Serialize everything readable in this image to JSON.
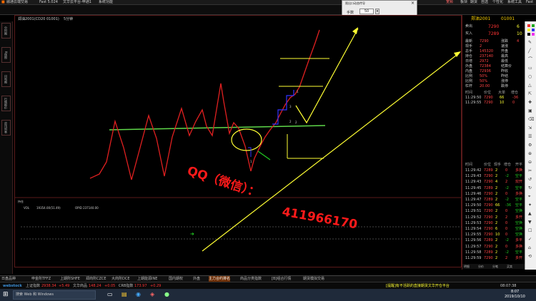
{
  "titlebar": {
    "app_name": "融通云端交易",
    "plate": "Fast  5.024",
    "menu_items": [
      "文华云平台-申通1",
      "系统功能"
    ],
    "right_menu": [
      "宽频",
      "板块",
      "期货",
      "自选",
      "个性化",
      "系统工具",
      "Fast"
    ]
  },
  "trade_panel": {
    "title": "限出口动态传导",
    "hand_label": "手数",
    "hand_value": "50",
    "close_label": "×"
  },
  "left_rail": {
    "tabs": [
      "分时图",
      "K线图",
      "闪电图",
      "行情报价",
      "资讯列表"
    ]
  },
  "chart": {
    "header": "郑油2001(CD20 01001)",
    "period": "5分钟",
    "watermark_prefix": "QQ（微信）：",
    "watermark_number": "411966170",
    "subpane_title": "持仓",
    "subpane_vol": "VOL",
    "subpane_readout": "19354.00(51.49)",
    "subpane_opi": "OPID 237140.00",
    "wave_labels": [
      "1",
      "2",
      "3",
      "1",
      "2"
    ]
  },
  "quote": {
    "symbol": "郑油2001",
    "code": "01001",
    "sell_label": "卖出",
    "sell_price": "7290",
    "sell_vol": "6",
    "buy_label": "买入",
    "buy_price": "7289",
    "buy_vol": "10",
    "stats": [
      {
        "l": "最新",
        "v": "7290",
        "l2": "涨跌",
        "v2": "4"
      },
      {
        "l": "现手",
        "v": "2",
        "l2": "速涨",
        "v2": ""
      },
      {
        "l": "总手",
        "v": "145320",
        "l2": "开盘",
        "v2": ""
      },
      {
        "l": "持仓",
        "v": "237140",
        "l2": "最高",
        "v2": ""
      },
      {
        "l": "日增",
        "v": "2972",
        "l2": "最低",
        "v2": ""
      },
      {
        "l": "外盘",
        "v": "72384",
        "l2": "结算价",
        "v2": ""
      },
      {
        "l": "内盘",
        "v": "72936",
        "l2": "昨收",
        "v2": ""
      },
      {
        "l": "比例",
        "v": "50%",
        "l2": "昨结",
        "v2": ""
      },
      {
        "l": "比例",
        "v": "50%",
        "l2": "涨停",
        "v2": ""
      },
      {
        "l": "杠杆",
        "v": "20.00",
        "l2": "跌停",
        "v2": ""
      }
    ],
    "ticks_header": [
      "时间",
      "价位",
      "大单",
      "增仓"
    ],
    "ticks_top": [
      {
        "t": "11:29:50",
        "p": "7290",
        "q": "66",
        "d": "-36"
      },
      {
        "t": "11:29:55",
        "p": "7290",
        "q": "10",
        "d": "0"
      }
    ],
    "ticks_header2": [
      "时间",
      "价位",
      "现手",
      "增仓",
      "开平"
    ],
    "ticks": [
      {
        "t": "11:29:42",
        "p": "7289",
        "q": "2",
        "d": "0",
        "k": "多换"
      },
      {
        "t": "11:29:43",
        "p": "7290",
        "q": "2",
        "d": "-2",
        "k": "空平"
      },
      {
        "t": "11:29:43",
        "p": "7290",
        "q": "4",
        "d": "2",
        "k": "双开"
      },
      {
        "t": "11:29:45",
        "p": "7289",
        "q": "2",
        "d": "-2",
        "k": "空平"
      },
      {
        "t": "11:29:46",
        "p": "7290",
        "q": "2",
        "d": "0",
        "k": "多换"
      },
      {
        "t": "11:29:47",
        "p": "7289",
        "q": "2",
        "d": "-2",
        "k": "空平"
      },
      {
        "t": "11:29:50",
        "p": "7290",
        "q": "66",
        "d": "-36",
        "k": "空平"
      },
      {
        "t": "11:29:51",
        "p": "7290",
        "q": "2",
        "d": "0",
        "k": "空换"
      },
      {
        "t": "11:29:52",
        "p": "7290",
        "q": "2",
        "d": "2",
        "k": "多开"
      },
      {
        "t": "11:29:53",
        "p": "7290",
        "q": "2",
        "d": "0",
        "k": "空换"
      },
      {
        "t": "11:29:54",
        "p": "7290",
        "q": "6",
        "d": "0",
        "k": "空换"
      },
      {
        "t": "11:29:55",
        "p": "7290",
        "q": "10",
        "d": "0",
        "k": "空换"
      },
      {
        "t": "11:29:56",
        "p": "7289",
        "q": "2",
        "d": "-2",
        "k": "多平"
      },
      {
        "t": "11:29:57",
        "p": "7290",
        "q": "2",
        "d": "0",
        "k": "多换"
      },
      {
        "t": "11:29:58",
        "p": "7289",
        "q": "2",
        "d": "-2",
        "k": "空平"
      },
      {
        "t": "11:29:59",
        "p": "7290",
        "q": "2",
        "d": "2",
        "k": "多开"
      }
    ],
    "footer": [
      "明细",
      "分价",
      "分笔",
      "买卖"
    ]
  },
  "tabbar": {
    "tabs": [
      "日盘品种",
      "申金所TFFZ",
      "上期所SHFE",
      "郑商所CZCE",
      "大商所DCE",
      "上期能源INE",
      "国内期权",
      "外盘",
      "主力合约排名",
      "商品分类指数",
      "[B]组合行情",
      "期货模拟交易"
    ]
  },
  "statusbar": {
    "brand": "wenhua",
    "brand_label": "webstock",
    "items": [
      {
        "label": "上证指数",
        "v": "2938.34",
        "c": "+5.49"
      },
      {
        "label": "文华商品",
        "v": "148.24",
        "c": "+0.05"
      },
      {
        "label": "CRB指数",
        "v": "173.97",
        "c": "+0.29"
      }
    ],
    "notice": "[提醒]有不活跃的直接期货文华开仓平台",
    "time": "08:07:38"
  },
  "taskbar": {
    "search_placeholder": "搜索 Web 和 Windows",
    "clock_time": "8:07",
    "clock_date": "2019/10/10"
  },
  "colors": {
    "accent_red": "#e02020",
    "accent_yellow": "#ffff33",
    "accent_green": "#22cc22",
    "accent_blue": "#3333ff"
  }
}
